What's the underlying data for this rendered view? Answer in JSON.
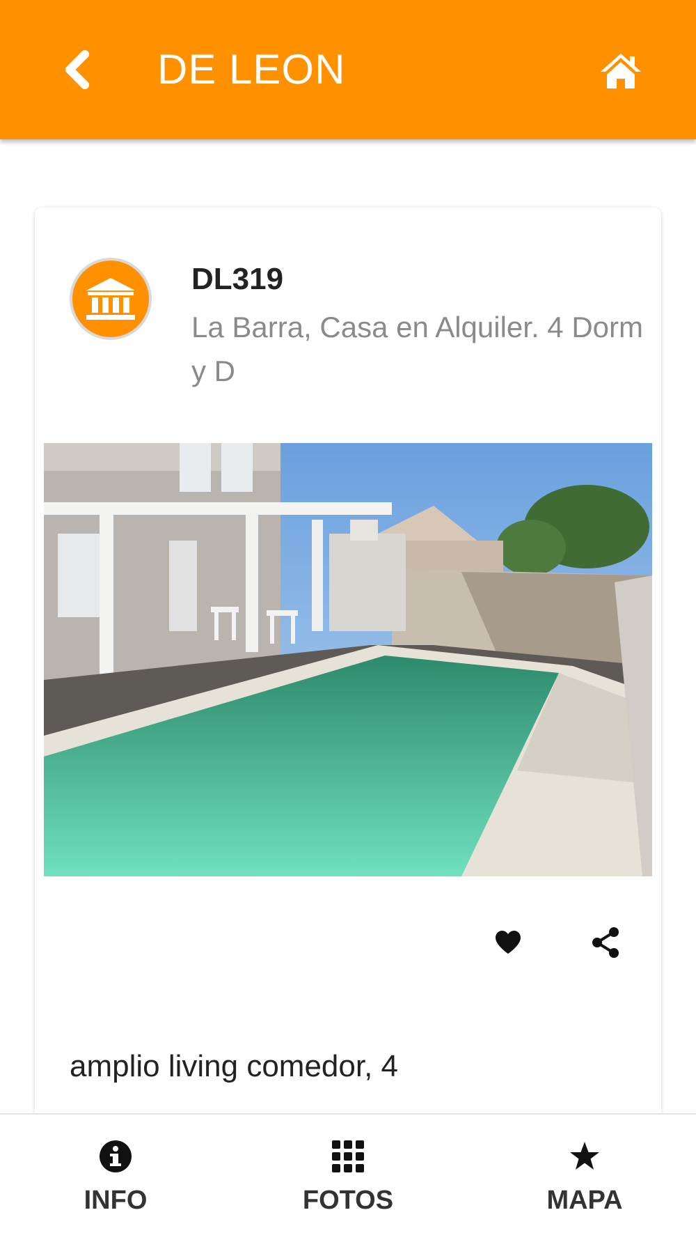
{
  "colors": {
    "brand": "#ff9100",
    "text": "#222222",
    "muted": "#8a8a8a"
  },
  "header": {
    "title": "DE LEON",
    "back_icon": "chevron-left-icon",
    "home_icon": "home-icon"
  },
  "listing": {
    "code": "DL319",
    "subtitle": "La Barra, Casa en Alquiler. 4 Dorm y D",
    "avatar_icon": "bank-icon",
    "actions": {
      "favorite_icon": "heart-icon",
      "share_icon": "share-icon"
    },
    "description": "amplio living comedor, 4"
  },
  "bottom_nav": [
    {
      "label": "INFO",
      "icon": "info-icon"
    },
    {
      "label": "FOTOS",
      "icon": "grid-icon"
    },
    {
      "label": "MAPA",
      "icon": "star-icon"
    }
  ]
}
